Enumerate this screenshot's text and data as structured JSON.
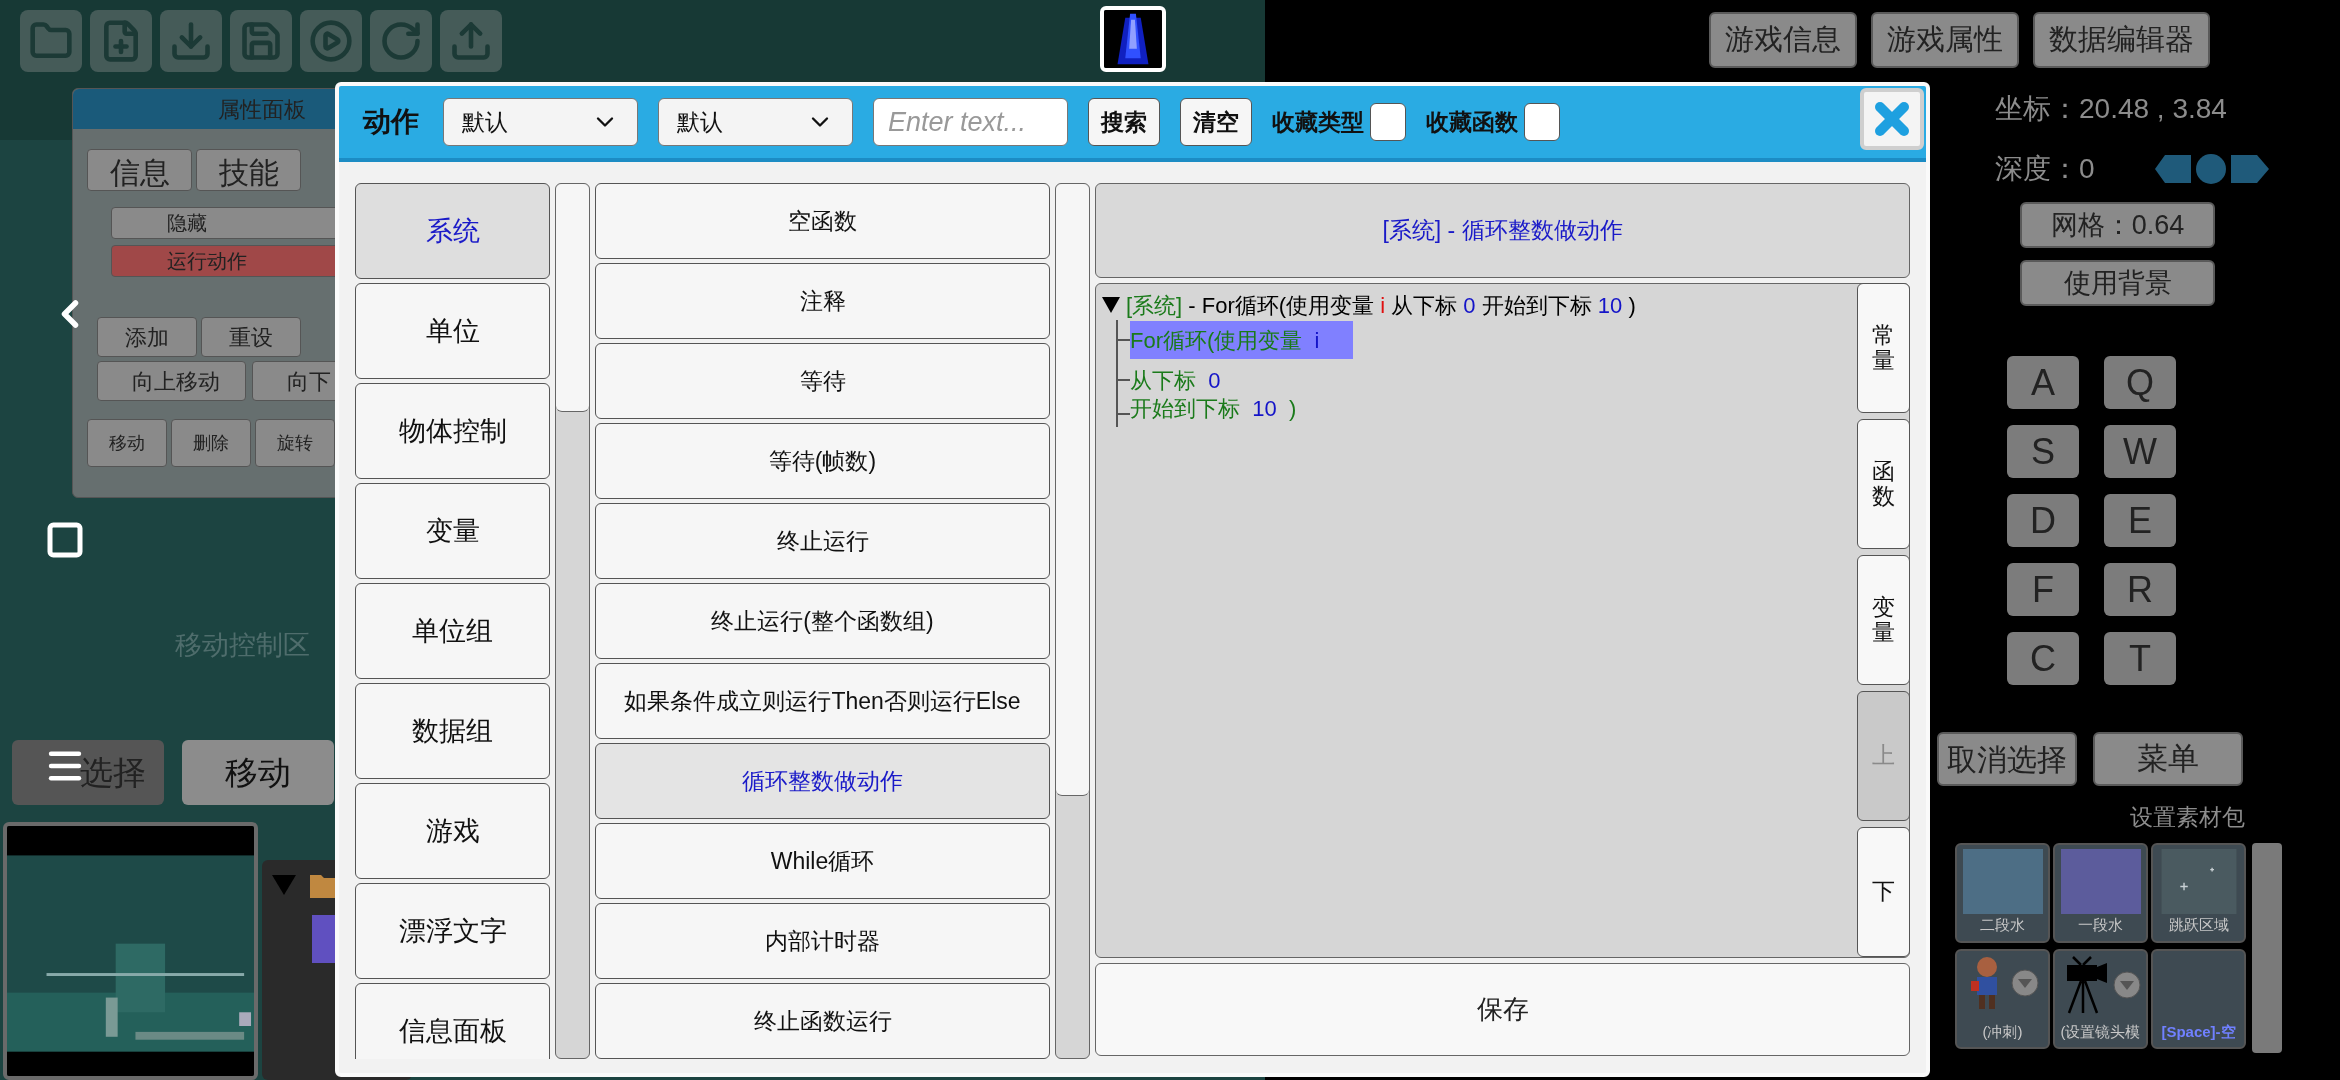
{
  "property_panel": {
    "title": "属性面板",
    "tabs": [
      {
        "label": "信息"
      },
      {
        "label": "技能"
      }
    ],
    "items": [
      {
        "label": "隐藏",
        "selected": false
      },
      {
        "label": "运行动作",
        "selected": true
      }
    ],
    "buttons": [
      "添加",
      "重设",
      "向上移动",
      "向下"
    ],
    "bottom_buttons": [
      "移动",
      "删除",
      "旋转"
    ]
  },
  "move_area_label": "移动控制区",
  "mode_buttons": [
    {
      "label": "选择",
      "selected": false
    },
    {
      "label": "移动",
      "selected": true
    }
  ],
  "top_buttons": [
    "游戏信息",
    "游戏属性",
    "数据编辑器"
  ],
  "coordinates": "坐标：20.48 , 3.84",
  "depth": "深度：0",
  "grid_button": "网格：0.64",
  "background_button": "使用背景",
  "keys": [
    "A",
    "Q",
    "S",
    "W",
    "D",
    "E",
    "F",
    "R",
    "C",
    "T"
  ],
  "cancel_button": "取消选择",
  "menu_button": "菜单",
  "asset_pack_label": "设置素材包",
  "assets": [
    {
      "label": "二段水",
      "kind": "swatch",
      "color": "#4d6e85"
    },
    {
      "label": "一段水",
      "kind": "swatch",
      "color": "#5c5c9c"
    },
    {
      "label": "跳跃区域",
      "kind": "stars",
      "color": "#4a5a60"
    },
    {
      "label": "(冲刺)",
      "kind": "character"
    },
    {
      "label": "(设置镜头模",
      "kind": "camera"
    },
    {
      "label": "[Space]-空",
      "kind": "blank"
    }
  ],
  "dialog": {
    "title": "动作",
    "filters": [
      {
        "value": "默认"
      },
      {
        "value": "默认"
      }
    ],
    "search": {
      "placeholder": "Enter text..."
    },
    "buttons": [
      "搜索",
      "清空"
    ],
    "favorites": [
      {
        "label": "收藏类型",
        "checked": false
      },
      {
        "label": "收藏函数",
        "checked": false
      }
    ],
    "categories": [
      {
        "label": "系统",
        "selected": true
      },
      {
        "label": "单位",
        "selected": false
      },
      {
        "label": "物体控制",
        "selected": false
      },
      {
        "label": "变量",
        "selected": false
      },
      {
        "label": "单位组",
        "selected": false
      },
      {
        "label": "数据组",
        "selected": false
      },
      {
        "label": "游戏",
        "selected": false
      },
      {
        "label": "漂浮文字",
        "selected": false
      },
      {
        "label": "信息面板",
        "selected": false
      }
    ],
    "functions": [
      {
        "label": "空函数",
        "selected": false
      },
      {
        "label": "注释",
        "selected": false
      },
      {
        "label": "等待",
        "selected": false
      },
      {
        "label": "等待(帧数)",
        "selected": false
      },
      {
        "label": "终止运行",
        "selected": false
      },
      {
        "label": "终止运行(整个函数组)",
        "selected": false
      },
      {
        "label": "如果条件成立则运行Then否则运行Else",
        "selected": false
      },
      {
        "label": "循环整数做动作",
        "selected": true
      },
      {
        "label": "While循环",
        "selected": false
      },
      {
        "label": "内部计时器",
        "selected": false
      },
      {
        "label": "终止函数运行",
        "selected": false
      }
    ],
    "heading": "[系统] - 循环整数做动作",
    "tree": {
      "expanded": true,
      "parts": [
        {
          "text": "[系统]",
          "kind": "tag"
        },
        {
          "text": " - For循环(使用变量 ",
          "kind": "plain"
        },
        {
          "text": "i",
          "kind": "variable"
        },
        {
          "text": " 从下标 ",
          "kind": "plain"
        },
        {
          "text": "0",
          "kind": "value"
        },
        {
          "text": " 开始到下标 ",
          "kind": "plain"
        },
        {
          "text": "10",
          "kind": "value"
        },
        {
          "text": " )",
          "kind": "plain"
        }
      ],
      "children": [
        {
          "selected": true,
          "parts": [
            {
              "text": "For循环(使用变量  ",
              "kind": "param"
            },
            {
              "text": "i",
              "kind": "value"
            }
          ]
        },
        {
          "selected": false,
          "parts": [
            {
              "text": "从下标  ",
              "kind": "param"
            },
            {
              "text": "0",
              "kind": "value"
            }
          ]
        },
        {
          "selected": false,
          "parts": [
            {
              "text": "开始到下标  ",
              "kind": "param"
            },
            {
              "text": "10",
              "kind": "value"
            },
            {
              "text": "  )",
              "kind": "param"
            }
          ]
        }
      ]
    },
    "side_tabs": [
      {
        "label": "常量",
        "disabled": false
      },
      {
        "label": "函数",
        "disabled": false
      },
      {
        "label": "变量",
        "disabled": false
      },
      {
        "label": "上",
        "disabled": true
      },
      {
        "label": "下",
        "disabled": false
      }
    ],
    "save_button": "保存"
  }
}
